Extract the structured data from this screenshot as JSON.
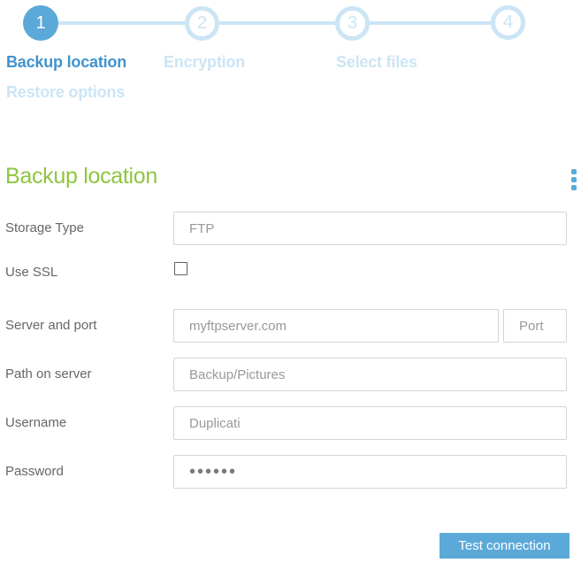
{
  "stepper": {
    "steps": [
      {
        "number": "1",
        "label": "Backup location",
        "state": "active"
      },
      {
        "number": "2",
        "label": "Encryption",
        "state": "upcoming"
      },
      {
        "number": "3",
        "label": "Select files",
        "state": "upcoming"
      },
      {
        "number": "4",
        "label": "Restore options",
        "state": "upcoming"
      }
    ]
  },
  "page": {
    "title": "Backup location"
  },
  "form": {
    "storage_type": {
      "label": "Storage Type",
      "value": "FTP"
    },
    "use_ssl": {
      "label": "Use SSL",
      "checked": false
    },
    "server": {
      "label": "Server and port",
      "value": "myftpserver.com",
      "port_placeholder": "Port"
    },
    "path": {
      "label": "Path on server",
      "value": "Backup/Pictures"
    },
    "username": {
      "label": "Username",
      "value": "Duplicati"
    },
    "password": {
      "label": "Password",
      "masked_value": "••••••"
    }
  },
  "actions": {
    "test_connection": "Test connection"
  },
  "colors": {
    "accent_blue": "#5ba9d9",
    "inactive_light_blue": "#cbe5f5",
    "active_step_label_blue": "#4093ce",
    "heading_green": "#8dc63f",
    "label_gray": "#666666",
    "input_text_gray": "#999999"
  }
}
